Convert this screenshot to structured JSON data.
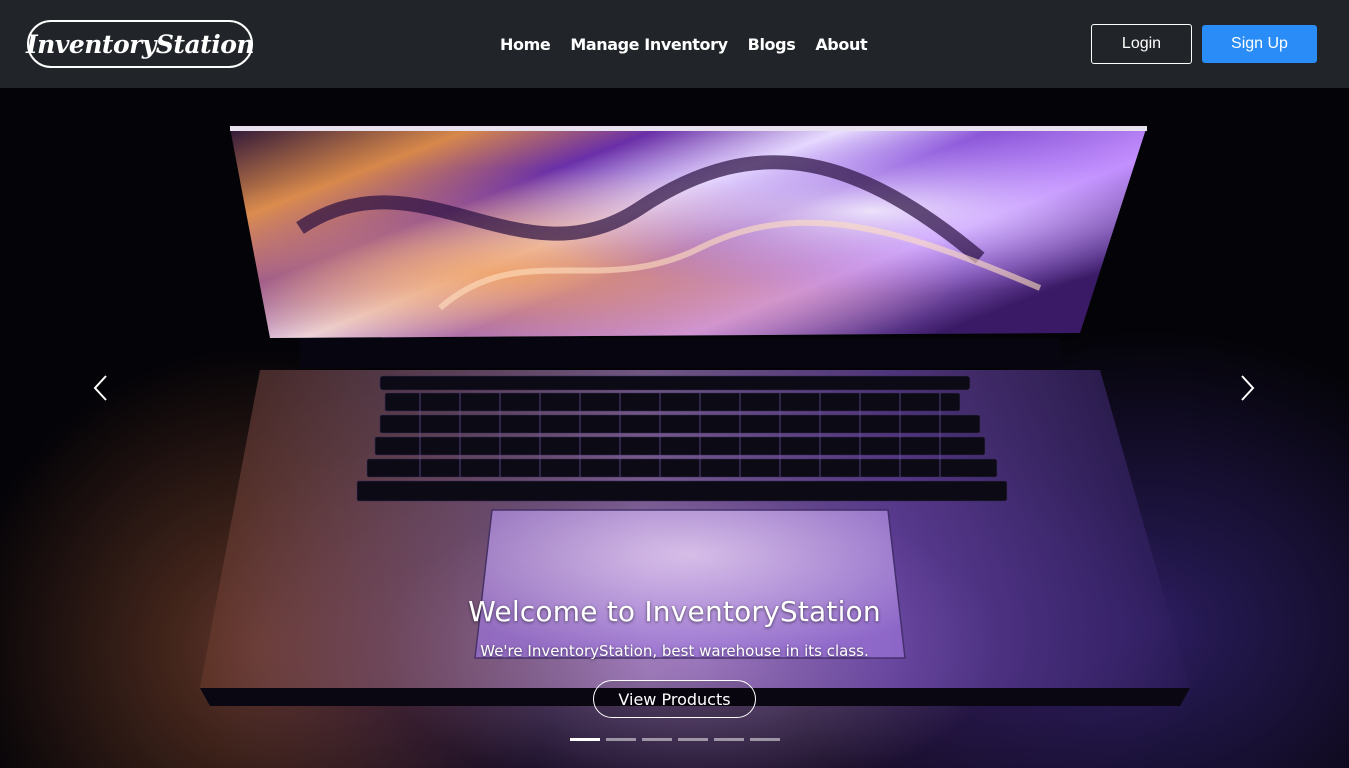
{
  "navbar": {
    "brand": "InventoryStation",
    "links": [
      "Home",
      "Manage Inventory",
      "Blogs",
      "About"
    ],
    "login_label": "Login",
    "signup_label": "Sign Up"
  },
  "hero": {
    "title": "Welcome to InventoryStation",
    "subtitle": "We're InventoryStation, best warehouse in its class.",
    "button_label": "View Products",
    "slide_count": 6,
    "active_slide": 1
  },
  "colors": {
    "navbar_bg": "#212529",
    "signup_bg": "#2a8cf6"
  }
}
